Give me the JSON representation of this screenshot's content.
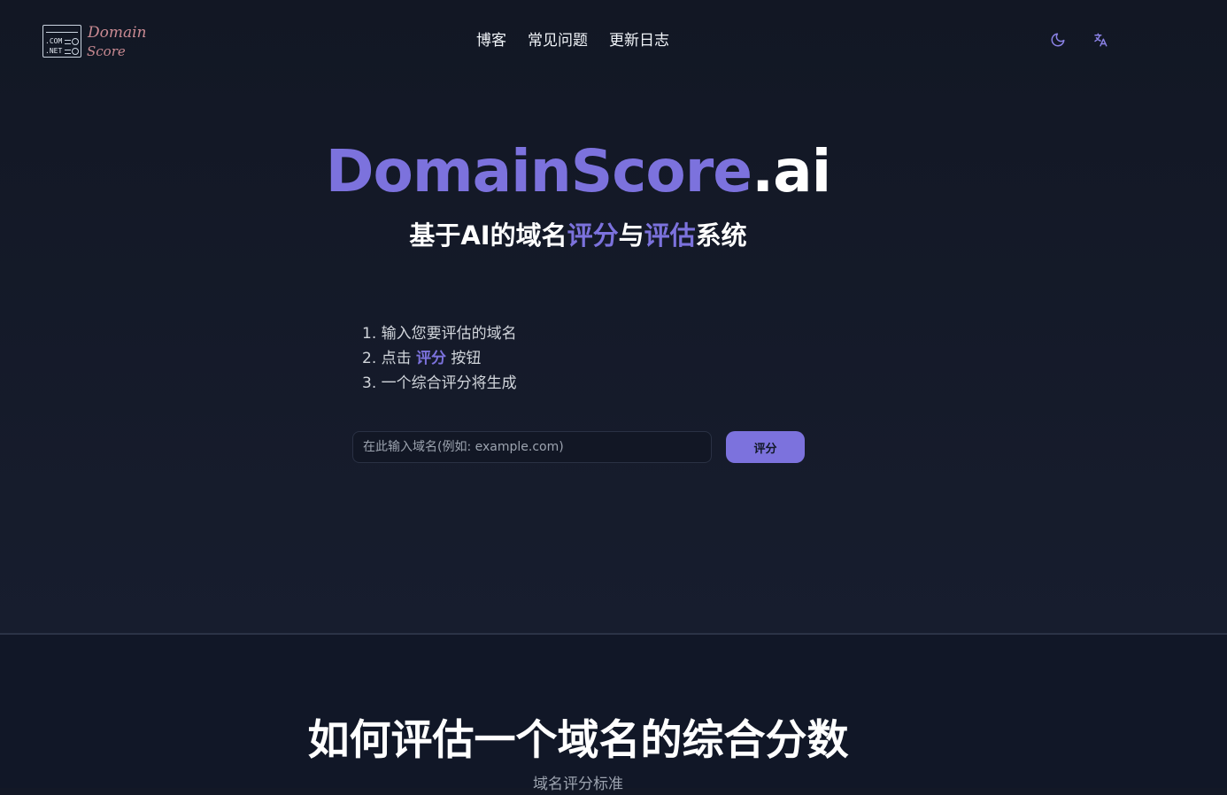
{
  "header": {
    "logo": {
      "box_line1": ".COM",
      "box_line2": ".NET",
      "word1": "Domain",
      "word2": "Score"
    },
    "nav": [
      {
        "label": "博客"
      },
      {
        "label": "常见问题"
      },
      {
        "label": "更新日志"
      }
    ],
    "icons": {
      "theme": "moon-icon",
      "language": "translate-icon"
    }
  },
  "hero": {
    "brand_main": "DomainScore",
    "brand_tld": ".ai",
    "subtitle": {
      "part1": "基于AI的域名",
      "accent1": "评分",
      "part2": "与",
      "accent2": "评估",
      "part3": "系统"
    },
    "steps": [
      {
        "text": "1. 输入您要评估的域名"
      },
      {
        "before": "2. 点击 ",
        "highlight": "评分",
        "after": " 按钮"
      },
      {
        "text": "3. 一个综合评分将生成"
      }
    ],
    "search": {
      "placeholder": "在此输入域名(例如: example.com)",
      "value": ""
    },
    "button_label": "评分"
  },
  "section": {
    "title": "如何评估一个域名的综合分数",
    "subtitle": "域名评分标准"
  },
  "colors": {
    "accent": "#7c72dd",
    "background": "#131826",
    "logo": "#c98a92"
  }
}
